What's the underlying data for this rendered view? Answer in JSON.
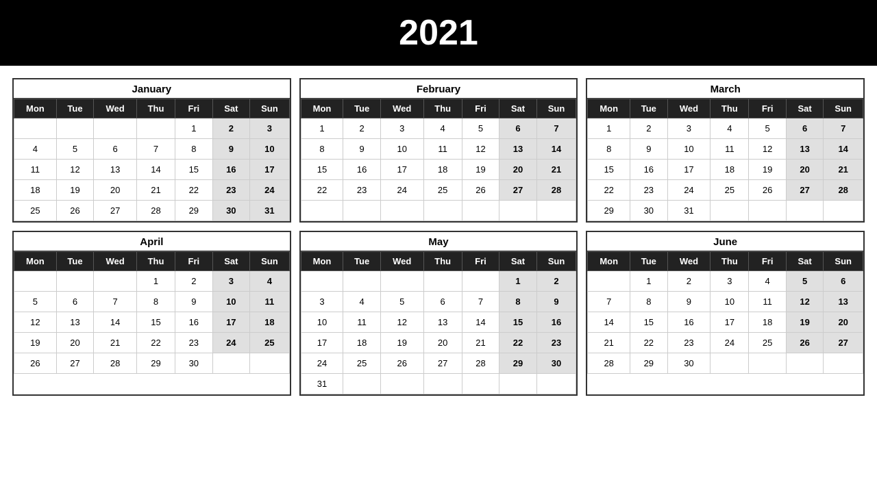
{
  "header": {
    "year": "2021"
  },
  "months": [
    {
      "name": "January",
      "days": [
        [
          "",
          "",
          "",
          "",
          "1",
          "2",
          "3"
        ],
        [
          "4",
          "5",
          "6",
          "7",
          "8",
          "9",
          "10"
        ],
        [
          "11",
          "12",
          "13",
          "14",
          "15",
          "16",
          "17"
        ],
        [
          "18",
          "19",
          "20",
          "21",
          "22",
          "23",
          "24"
        ],
        [
          "25",
          "26",
          "27",
          "28",
          "29",
          "30",
          "31"
        ]
      ]
    },
    {
      "name": "February",
      "days": [
        [
          "1",
          "2",
          "3",
          "4",
          "5",
          "6",
          "7"
        ],
        [
          "8",
          "9",
          "10",
          "11",
          "12",
          "13",
          "14"
        ],
        [
          "15",
          "16",
          "17",
          "18",
          "19",
          "20",
          "21"
        ],
        [
          "22",
          "23",
          "24",
          "25",
          "26",
          "27",
          "28"
        ],
        [
          "",
          "",
          "",
          "",
          "",
          "",
          ""
        ]
      ]
    },
    {
      "name": "March",
      "days": [
        [
          "1",
          "2",
          "3",
          "4",
          "5",
          "6",
          "7"
        ],
        [
          "8",
          "9",
          "10",
          "11",
          "12",
          "13",
          "14"
        ],
        [
          "15",
          "16",
          "17",
          "18",
          "19",
          "20",
          "21"
        ],
        [
          "22",
          "23",
          "24",
          "25",
          "26",
          "27",
          "28"
        ],
        [
          "29",
          "30",
          "31",
          "",
          "",
          "",
          ""
        ]
      ]
    },
    {
      "name": "April",
      "days": [
        [
          "",
          "",
          "",
          "1",
          "2",
          "3",
          "4"
        ],
        [
          "5",
          "6",
          "7",
          "8",
          "9",
          "10",
          "11"
        ],
        [
          "12",
          "13",
          "14",
          "15",
          "16",
          "17",
          "18"
        ],
        [
          "19",
          "20",
          "21",
          "22",
          "23",
          "24",
          "25"
        ],
        [
          "26",
          "27",
          "28",
          "29",
          "30",
          "",
          ""
        ]
      ]
    },
    {
      "name": "May",
      "days": [
        [
          "",
          "",
          "",
          "",
          "",
          "1",
          "2"
        ],
        [
          "3",
          "4",
          "5",
          "6",
          "7",
          "8",
          "9"
        ],
        [
          "10",
          "11",
          "12",
          "13",
          "14",
          "15",
          "16"
        ],
        [
          "17",
          "18",
          "19",
          "20",
          "21",
          "22",
          "23"
        ],
        [
          "24",
          "25",
          "26",
          "27",
          "28",
          "29",
          "30"
        ],
        [
          "31",
          "",
          "",
          "",
          "",
          "",
          ""
        ]
      ]
    },
    {
      "name": "June",
      "days": [
        [
          "",
          "1",
          "2",
          "3",
          "4",
          "5",
          "6"
        ],
        [
          "7",
          "8",
          "9",
          "10",
          "11",
          "12",
          "13"
        ],
        [
          "14",
          "15",
          "16",
          "17",
          "18",
          "19",
          "20"
        ],
        [
          "21",
          "22",
          "23",
          "24",
          "25",
          "26",
          "27"
        ],
        [
          "28",
          "29",
          "30",
          "",
          "",
          "",
          ""
        ]
      ]
    }
  ],
  "weekdays": [
    "Mon",
    "Tue",
    "Wed",
    "Thu",
    "Fri",
    "Sat",
    "Sun"
  ]
}
